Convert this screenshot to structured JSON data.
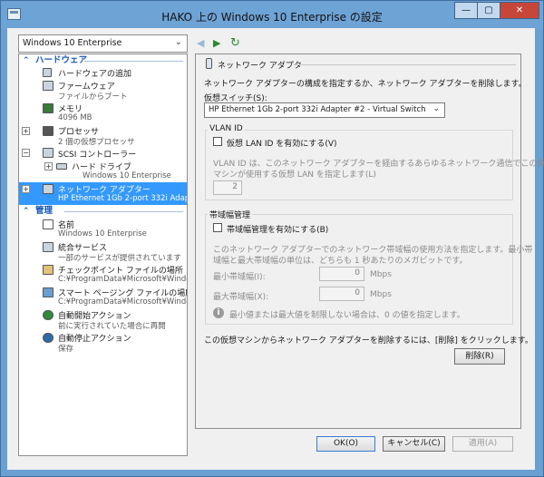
{
  "window": {
    "title": "HAKO 上の Windows 10 Enterprise の設定"
  },
  "vm_select": {
    "value": "Windows 10 Enterprise"
  },
  "tree": {
    "hardware_header": "ハードウェア",
    "management_header": "管理",
    "hardware_items": [
      {
        "label": "ハードウェアの追加",
        "sub": ""
      },
      {
        "label": "ファームウェア",
        "sub": "ファイルからブート"
      },
      {
        "label": "メモリ",
        "sub": "4096 MB"
      },
      {
        "label": "プロセッサ",
        "sub": "2 個の仮想プロセッサ"
      },
      {
        "label": "SCSI コントローラー",
        "sub": ""
      },
      {
        "label": "ハード ドライブ",
        "sub": "Windows 10 Enterprise"
      },
      {
        "label": "ネットワーク アダプター",
        "sub": "HP Ethernet 1Gb 2-port 332i Adap..."
      }
    ],
    "management_items": [
      {
        "label": "名前",
        "sub": "Windows 10 Enterprise"
      },
      {
        "label": "統合サービス",
        "sub": "一部のサービスが提供されています"
      },
      {
        "label": "チェックポイント ファイルの場所",
        "sub": "C:¥ProgramData¥Microsoft¥Windo..."
      },
      {
        "label": "スマート ページング ファイルの場所",
        "sub": "C:¥ProgramData¥Microsoft¥Windo..."
      },
      {
        "label": "自動開始アクション",
        "sub": "前に実行されていた場合に再開"
      },
      {
        "label": "自動停止アクション",
        "sub": "保存"
      }
    ]
  },
  "panel": {
    "header": "ネットワーク アダプター",
    "description": "ネットワーク アダプターの構成を指定するか、ネットワーク アダプターを削除します。",
    "switch_label": "仮想スイッチ(S):",
    "switch_value": "HP Ethernet 1Gb 2-port 332i Adapter #2 - Virtual Switch",
    "vlan": {
      "title": "VLAN ID",
      "checkbox": "仮想 LAN ID を有効にする(V)",
      "desc1": "VLAN ID は、このネットワーク アダプターを経由するあらゆるネットワーク通信でこの仮想",
      "desc2": "マシンが使用する仮想 LAN を指定します(L)",
      "value": "2"
    },
    "bandwidth": {
      "title": "帯域幅管理",
      "checkbox": "帯域幅管理を有効にする(B)",
      "desc1": "このネットワーク アダプターでのネットワーク帯域幅の使用方法を指定します。最小帯",
      "desc2": "域幅と最大帯域幅の単位は、どちらも 1 秒あたりのメガビットです。",
      "min_label": "最小帯域幅(I):",
      "min_value": "0",
      "max_label": "最大帯域幅(X):",
      "max_value": "0",
      "unit": "Mbps",
      "note": "最小値または最大値を制限しない場合は、0 の値を指定します。"
    },
    "remove_text": "この仮想マシンからネットワーク アダプターを削除するには、[削除] をクリックします。",
    "remove_button": "削除(R)"
  },
  "buttons": {
    "ok": "OK(O)",
    "cancel": "キャンセル(C)",
    "apply": "適用(A)"
  }
}
